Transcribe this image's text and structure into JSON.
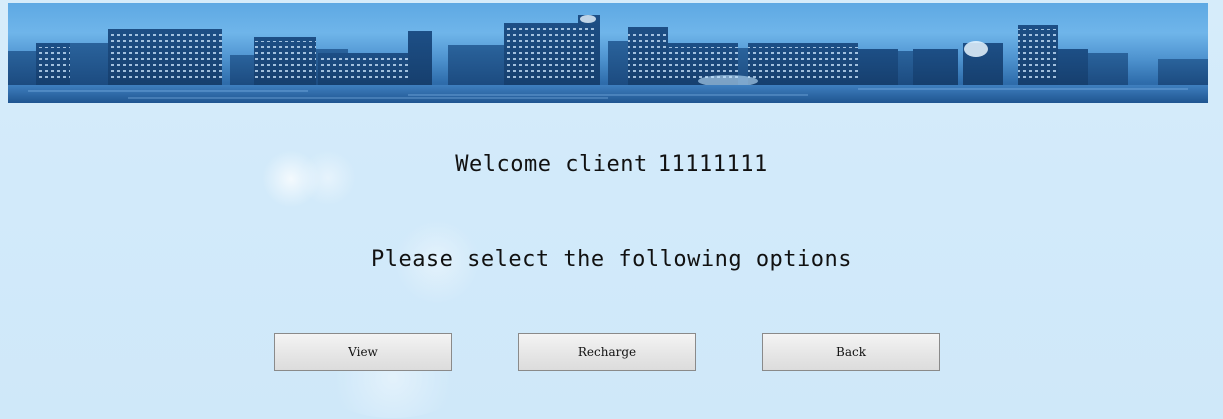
{
  "banner": {
    "description_icon": "city-skyline-banner"
  },
  "welcome": {
    "prefix": "Welcome client",
    "client_id": "11111111"
  },
  "prompt": {
    "text": "Please select the following options"
  },
  "buttons": {
    "view": "View",
    "recharge": "Recharge",
    "back": "Back"
  },
  "colors": {
    "background": "#d4ebfa",
    "banner_sky": "#5ea9e3",
    "banner_water": "#2a5f98",
    "button_border": "#8a8a8a",
    "text": "#111111"
  }
}
